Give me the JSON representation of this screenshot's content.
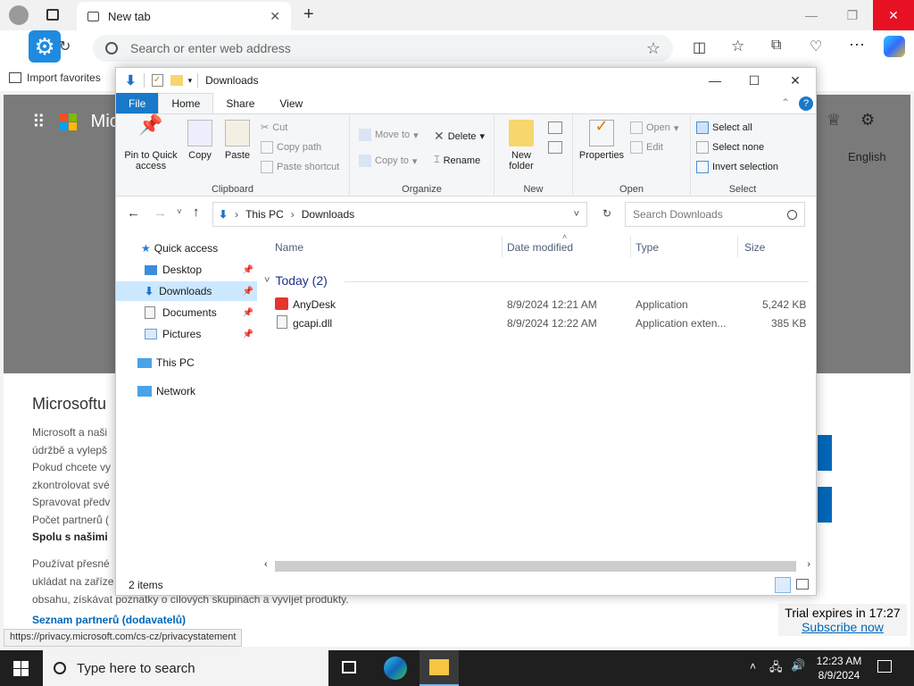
{
  "browser": {
    "tab_title": "New tab",
    "address_placeholder": "Search or enter web address",
    "favorites_import": "Import favorites"
  },
  "page": {
    "brand": "Mic",
    "language": "English",
    "cookie_title": "Microsoftu",
    "cookie_lines": [
      "Microsoft a naši",
      "údržbě a vylepš",
      "Pokud chcete vy",
      "zkontrolovat své",
      "Spravovat předv",
      "Počet partnerů ("
    ],
    "cookie_bold": "Spolu s našimi",
    "cookie_lines2": [
      "Používat přesné",
      "ukládat na zaříze"
    ],
    "cookie_line3": "obsahu, získávat poznatky o cílových skupinách a vyvíjet produkty.",
    "partners_link": "Seznam partnerů (dodavatelů)",
    "status_url": "https://privacy.microsoft.com/cs-cz/privacystatement",
    "trial_text": "Trial expires in 17:27",
    "subscribe": "Subscribe now"
  },
  "explorer": {
    "title": "Downloads",
    "tabs": [
      "File",
      "Home",
      "Share",
      "View"
    ],
    "clipboard": {
      "pin": "Pin to Quick access",
      "copy": "Copy",
      "paste": "Paste",
      "cut": "Cut",
      "copy_path": "Copy path",
      "paste_shortcut": "Paste shortcut",
      "label": "Clipboard"
    },
    "organize": {
      "move_to": "Move to",
      "copy_to": "Copy to",
      "delete": "Delete",
      "rename": "Rename",
      "label": "Organize"
    },
    "new": {
      "new_folder": "New folder",
      "label": "New"
    },
    "open": {
      "properties": "Properties",
      "open": "Open",
      "edit": "Edit",
      "label": "Open"
    },
    "select": {
      "select_all": "Select all",
      "select_none": "Select none",
      "invert": "Invert selection",
      "label": "Select"
    },
    "breadcrumb": [
      "This PC",
      "Downloads"
    ],
    "search_placeholder": "Search Downloads",
    "nav": {
      "quick_access": "Quick access",
      "desktop": "Desktop",
      "downloads": "Downloads",
      "documents": "Documents",
      "pictures": "Pictures",
      "this_pc": "This PC",
      "network": "Network"
    },
    "columns": [
      "Name",
      "Date modified",
      "Type",
      "Size"
    ],
    "group": "Today (2)",
    "files": [
      {
        "name": "AnyDesk",
        "date": "8/9/2024 12:21 AM",
        "type": "Application",
        "size": "5,242 KB",
        "icon": "anydesk-icon"
      },
      {
        "name": "gcapi.dll",
        "date": "8/9/2024 12:22 AM",
        "type": "Application exten...",
        "size": "385 KB",
        "icon": "dll-file-icon"
      }
    ],
    "status": "2 items"
  },
  "taskbar": {
    "search": "Type here to search",
    "time": "12:23 AM",
    "date": "8/9/2024"
  }
}
